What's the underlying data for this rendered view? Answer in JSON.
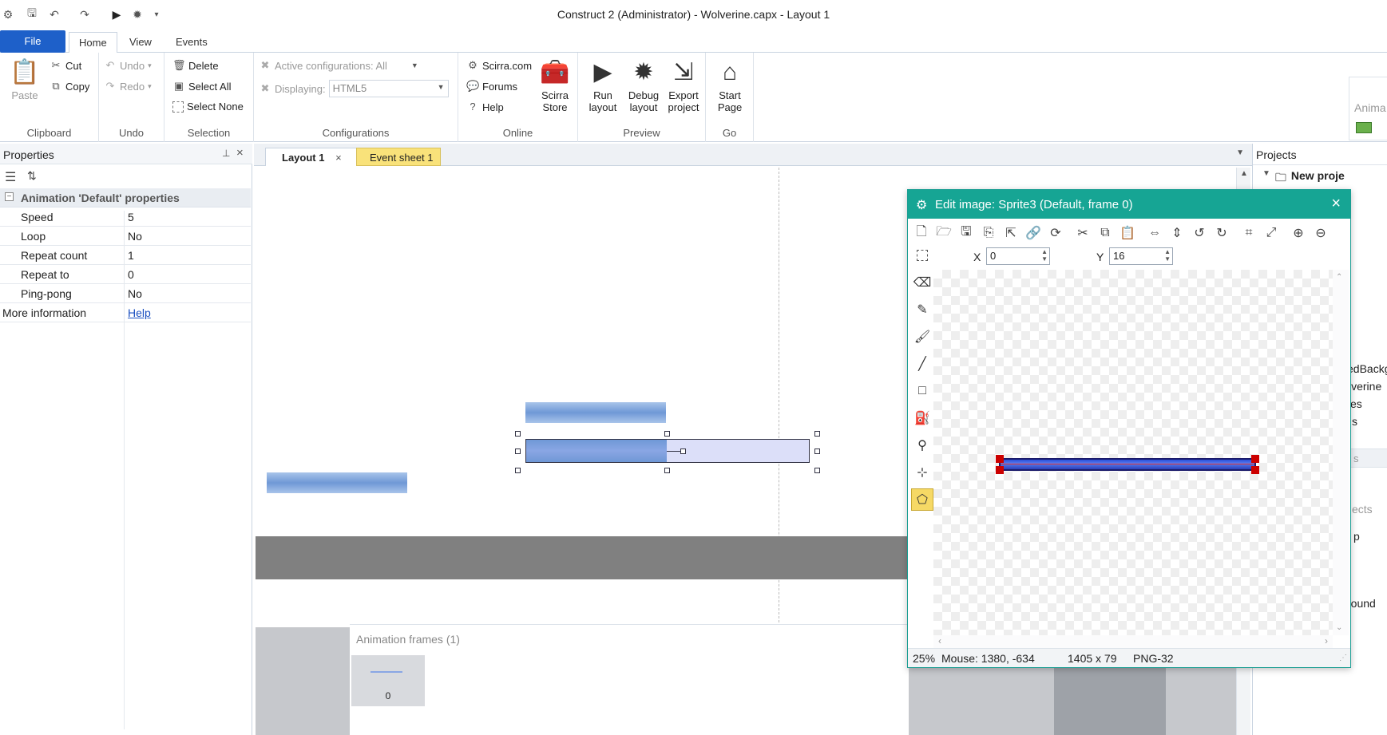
{
  "window": {
    "title": "Construct 2 (Administrator) - Wolverine.capx - Layout 1"
  },
  "ribbon_tabs": [
    "File",
    "Home",
    "View",
    "Events"
  ],
  "clipboard": {
    "paste": "Paste",
    "cut": "Cut",
    "copy": "Copy",
    "label": "Clipboard"
  },
  "undo": {
    "undo": "Undo",
    "redo": "Redo",
    "label": "Undo"
  },
  "selection": {
    "delete": "Delete",
    "select_all": "Select All",
    "select_none": "Select None",
    "label": "Selection"
  },
  "configurations": {
    "active": "Active configurations: All",
    "displaying": "Displaying:",
    "displaying_value": "HTML5",
    "label": "Configurations"
  },
  "online": {
    "scirra": "Scirra.com",
    "forums": "Forums",
    "help": "Help",
    "store_line1": "Scirra",
    "store_line2": "Store",
    "label": "Online"
  },
  "preview": {
    "run_1": "Run",
    "run_2": "layout",
    "debug_1": "Debug",
    "debug_2": "layout",
    "export_1": "Export",
    "export_2": "project",
    "label": "Preview"
  },
  "go": {
    "start_1": "Start",
    "start_2": "Page",
    "label": "Go"
  },
  "properties": {
    "title": "Properties",
    "section": "Animation 'Default' properties",
    "rows": [
      {
        "key": "Speed",
        "value": "5"
      },
      {
        "key": "Loop",
        "value": "No"
      },
      {
        "key": "Repeat count",
        "value": "1"
      },
      {
        "key": "Repeat to",
        "value": "0"
      },
      {
        "key": "Ping-pong",
        "value": "No"
      }
    ],
    "more_info_key": "More information",
    "more_info_link": "Help"
  },
  "doc_tabs": {
    "layout": "Layout 1",
    "event_sheet": "Event sheet 1"
  },
  "projects": {
    "title": "Projects",
    "root": "New proje",
    "partial_items": [
      "Anima",
      "edBackg",
      "lverine",
      "es",
      "s",
      "s",
      "ects",
      "p",
      "round"
    ]
  },
  "editor": {
    "title": "Edit image: Sprite3 (Default, frame 0)",
    "x_label": "X",
    "x_value": "0",
    "y_label": "Y",
    "y_value": "16",
    "zoom": "25%",
    "mouse": "Mouse: 1380, -634",
    "size": "1405 x 79",
    "format": "PNG-32"
  },
  "animation_frames": {
    "title": "Animation frames (1)",
    "frame_index": "0"
  },
  "colors": {
    "file_tab": "#1e60c9",
    "editor_header": "#16a594",
    "event_tab": "#f9e27a",
    "link": "#1a4fc0"
  }
}
